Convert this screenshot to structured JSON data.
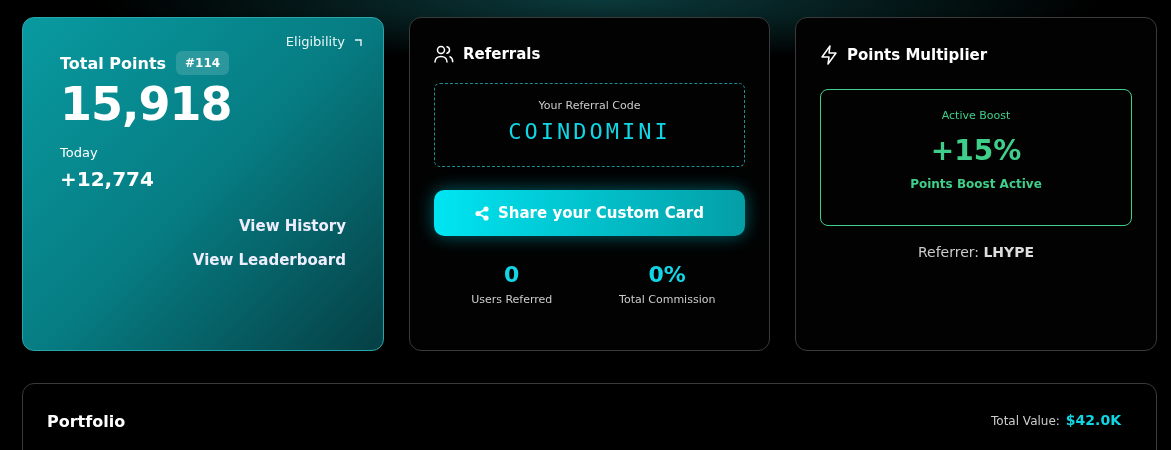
{
  "points_card": {
    "eligibility_link": "Eligibility",
    "title": "Total Points",
    "rank": "#114",
    "total": "15,918",
    "today_label": "Today",
    "today_value": "+12,774",
    "links": [
      "View History",
      "View Leaderboard"
    ]
  },
  "referrals_card": {
    "title": "Referrals",
    "code_label": "Your Referral Code",
    "code": "COINDOMINI",
    "share_button": "Share your Custom Card",
    "stats": [
      {
        "value": "0",
        "label": "Users Referred"
      },
      {
        "value": "0%",
        "label": "Total Commission"
      }
    ]
  },
  "multiplier_card": {
    "title": "Points Multiplier",
    "boost_label": "Active Boost",
    "boost_value": "+15%",
    "boost_status": "Points Boost Active",
    "referrer": "Referrer: **LHYPE**"
  },
  "portfolio": {
    "title": "Portfolio",
    "total_label": "Total Value:",
    "total_value": "$42.0K"
  }
}
